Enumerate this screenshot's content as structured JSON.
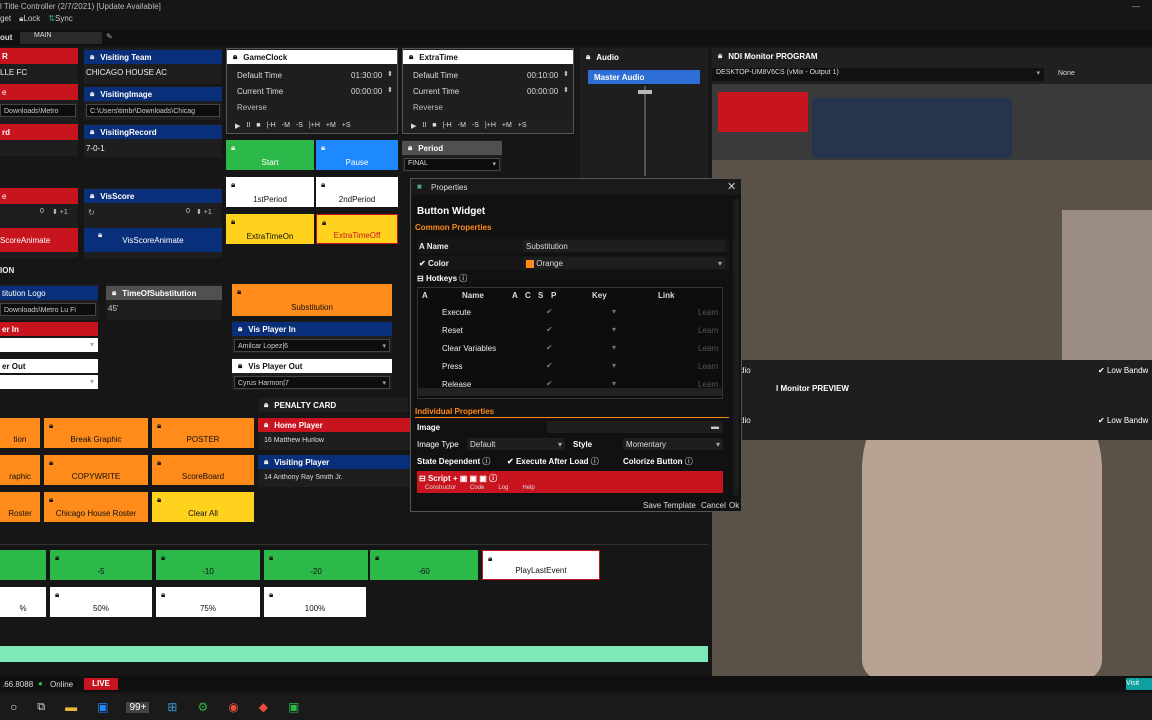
{
  "window": {
    "title": "l Title Controller (2/7/2021) [Update Available]",
    "min": "—"
  },
  "menu": {
    "get": "get",
    "lock": "Lock",
    "sync": "Sync"
  },
  "layout": {
    "label": "out",
    "main": "MAIN"
  },
  "colors": {
    "red": "#c8141e",
    "blue": "#0a2f7a",
    "orange": "#ff8c1a",
    "yellow": "#ffd21e",
    "green": "#2db84a",
    "white": "#ffffff",
    "panel": "#1e1e1e"
  },
  "left": {
    "frag1": "R",
    "frag2": "LLE FC",
    "frag3": "e",
    "frag4": "Downloads\\Metro",
    "frag5": "rd",
    "frag6": "e",
    "frag7": "ScoreAnimate",
    "frag8": "ION",
    "frag9": "titution Logo",
    "frag10": "Downloads\\Metro Lu Fi",
    "frag11": "er In",
    "frag12": "er Out",
    "score_left": "0"
  },
  "visiting_team": {
    "title": "Visiting Team",
    "value": "CHICAGO HOUSE AC"
  },
  "visiting_image": {
    "title": "VisitingImage",
    "value": "C:\\Users\\timbr\\Downloads\\Chicag"
  },
  "visiting_record": {
    "title": "VisitingRecord",
    "value": "7-0-1"
  },
  "vis_score": {
    "title": "VisScore",
    "value": "0",
    "button": "VisScoreAnimate"
  },
  "game_clock": {
    "title": "GameClock",
    "default_label": "Default Time",
    "default_value": "01:30:00",
    "current_label": "Current Time",
    "current_value": "00:00:00",
    "reverse": "Reverse",
    "controls": [
      "▶",
      "II",
      "■",
      "|-H",
      "-M",
      "-S",
      "|+H",
      "+M",
      "+S"
    ]
  },
  "extra_time": {
    "title": "ExtraTime",
    "default_label": "Default Time",
    "default_value": "00:10:00",
    "current_label": "Current Time",
    "current_value": "00:00:00",
    "reverse": "Reverse",
    "controls": [
      "▶",
      "II",
      "■",
      "|-H",
      "-M",
      "-S",
      "|+H",
      "+M",
      "+S"
    ]
  },
  "period": {
    "title": "Period",
    "value": "FINAL"
  },
  "buttons_grid": {
    "start": "Start",
    "pause": "Pause",
    "first": "1stPeriod",
    "second": "2ndPeriod",
    "extra_on": "ExtraTimeOn",
    "extra_off": "ExtraTimeOff"
  },
  "audio": {
    "title": "Audio",
    "master": "Master Audio"
  },
  "ndi_program": {
    "title": "NDI Monitor PROGRAM",
    "source": "DESKTOP-UM8V6CS (vMix - Output 1)",
    "none": "None"
  },
  "ndi_preview": {
    "title": "l Monitor PREVIEW",
    "frag": "dio",
    "frag2": "dio",
    "low1": "Low Bandw",
    "low2": "Low Bandw"
  },
  "substitution": {
    "time_title": "TimeOfSubstitution",
    "time_value": "45'",
    "button": "Substitution"
  },
  "vis_player_in": {
    "title": "Vis Player In",
    "value": "Amilcar Lopez|6"
  },
  "vis_player_out": {
    "title": "Vis Player Out",
    "value": "Cyrus Harmon|7"
  },
  "penalty": {
    "title": "PENALTY CARD",
    "home_title": "Home Player",
    "home_value": "16 Matthew Hurlow",
    "vis_title": "Visiting Player",
    "vis_value": "14 Anthony Ray Smith Jr."
  },
  "graphics": {
    "g1": "tion",
    "g2": "Break Graphic",
    "g3": "POSTER",
    "g4": "raphic",
    "g5": "COPYWRITE",
    "g6": "ScoreBoard",
    "g7": "Roster",
    "g8": "Chicago House Roster",
    "g9": "Clear All"
  },
  "bottom_buttons": {
    "m5": "-5",
    "m10": "-10",
    "m20": "-20",
    "m60": "-60",
    "playlast": "PlayLastEvent",
    "p50": "50%",
    "p75": "75%",
    "p100": "100%",
    "pct": "%"
  },
  "properties": {
    "window_title": "Properties",
    "heading": "Button Widget",
    "common": "Common Properties",
    "name_label": "Name",
    "name_value": "Substitution",
    "color_label": "Color",
    "color_value": "Orange",
    "hotkeys": "Hotkeys",
    "columns": [
      "A",
      "Name",
      "A",
      "C",
      "S",
      "P",
      "Key",
      "Link"
    ],
    "rows": [
      {
        "name": "Execute",
        "learn": "Learn"
      },
      {
        "name": "Reset",
        "learn": "Learn"
      },
      {
        "name": "Clear Variables",
        "learn": "Learn"
      },
      {
        "name": "Press",
        "learn": "Learn"
      },
      {
        "name": "Release",
        "learn": "Learn"
      }
    ],
    "individual": "Individual Properties",
    "image_label": "Image",
    "image_type_label": "Image Type",
    "image_type_value": "Default",
    "style_label": "Style",
    "style_value": "Momentary",
    "state_dependent": "State Dependent",
    "execute_after_load": "Execute After Load",
    "colorize_button": "Colorize Button",
    "script": "Script",
    "tabs": [
      "Constructor",
      "Code",
      "Log",
      "Help"
    ],
    "save_template": "Save Template",
    "cancel": "Cancel",
    "ok": "Ok"
  },
  "status": {
    "ip": ".66.8088",
    "online": "Online",
    "live": "LIVE",
    "right": "Visit"
  },
  "taskbar": {
    "badge": "99+"
  }
}
